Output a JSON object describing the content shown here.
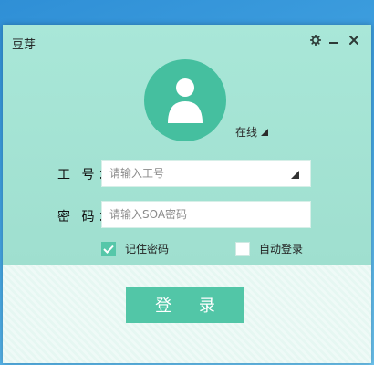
{
  "window": {
    "title": "豆芽"
  },
  "controls": {
    "settings_icon": "gear-icon",
    "minimize_icon": "minimize-icon",
    "close_icon": "close-icon"
  },
  "avatar": {
    "icon": "user-avatar-icon"
  },
  "status": {
    "label": "在线"
  },
  "form": {
    "id_label": "工 号：",
    "id_placeholder": "请输入工号",
    "id_value": "",
    "pw_label": "密 码：",
    "pw_placeholder": "请输入SOA密码",
    "pw_value": ""
  },
  "options": {
    "remember_label": "记住密码",
    "remember_checked": true,
    "auto_label": "自动登录",
    "auto_checked": false
  },
  "login": {
    "label": "登 录"
  },
  "colors": {
    "accent": "#52c6a7",
    "panel": "#a9e7d8",
    "desktop": "#3c9edd"
  }
}
